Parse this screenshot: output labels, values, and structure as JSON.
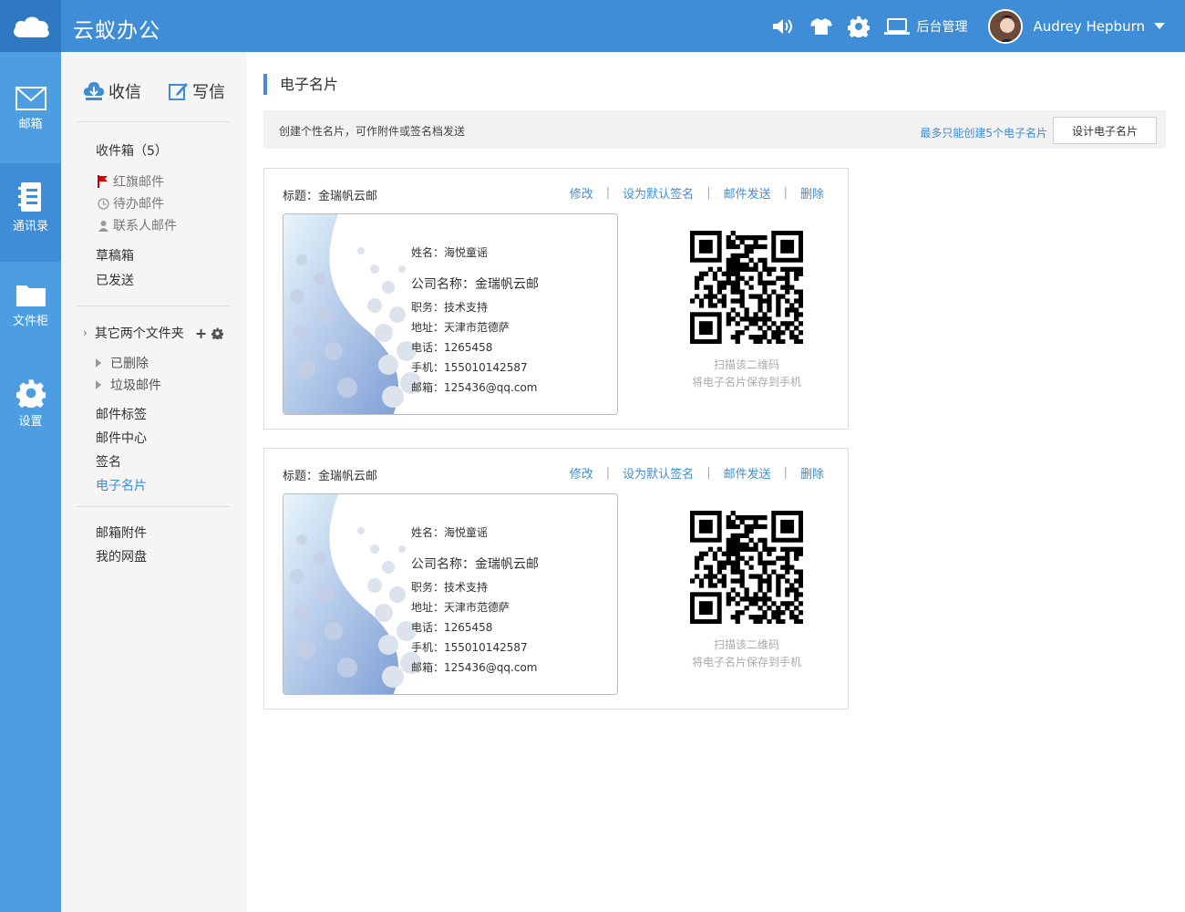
{
  "app": {
    "title": "云蚁办公"
  },
  "header": {
    "admin_label": "后台管理",
    "username": "Audrey Hepburn",
    "icons": [
      "speaker-icon",
      "tshirt-icon",
      "gear-icon",
      "laptop-icon"
    ]
  },
  "leftnav": [
    {
      "label": "邮箱",
      "icon": "envelope-icon"
    },
    {
      "label": "通讯录",
      "icon": "address-book-icon"
    },
    {
      "label": "文件柜",
      "icon": "folder-icon"
    },
    {
      "label": "设置",
      "icon": "gear-icon"
    }
  ],
  "sidebar": {
    "receive": "收信",
    "compose": "写信",
    "inbox": "收件箱（5）",
    "flagged": "红旗邮件",
    "todo": "待办邮件",
    "contacts_mail": "联系人邮件",
    "drafts": "草稿箱",
    "sent": "已发送",
    "other_folders": "其它两个文件夹",
    "deleted": "已删除",
    "spam": "垃圾邮件",
    "tags": "邮件标签",
    "mail_center": "邮件中心",
    "signature": "签名",
    "ecard": "电子名片",
    "attachments": "邮箱附件",
    "netdisk": "我的网盘"
  },
  "main": {
    "page_title": "电子名片",
    "info_text": "创建个性名片，可作附件或签名档发送",
    "limit_text": "最多只能创建5个电子名片",
    "design_button": "设计电子名片",
    "cards": [
      {
        "title": "标题：金瑞帆云邮",
        "actions": {
          "edit": "修改",
          "set_default": "设为默认签名",
          "send": "邮件发送",
          "delete": "删除"
        },
        "name": "姓名：海悦童谣",
        "company": "公司名称：金瑞帆云邮",
        "position": "职务：技术支持",
        "address": "地址：天津市范德萨",
        "phone": "电话：1265458",
        "mobile": "手机：155010142587",
        "email": "邮箱：125436@qq.com",
        "qr_caption1": "扫描该二维码",
        "qr_caption2": "将电子名片保存到手机"
      },
      {
        "title": "标题：金瑞帆云邮",
        "actions": {
          "edit": "修改",
          "set_default": "设为默认签名",
          "send": "邮件发送",
          "delete": "删除"
        },
        "name": "姓名：海悦童谣",
        "company": "公司名称：金瑞帆云邮",
        "position": "职务：技术支持",
        "address": "地址：天津市范德萨",
        "phone": "电话：1265458",
        "mobile": "手机：155010142587",
        "email": "邮箱：125436@qq.com",
        "qr_caption1": "扫描该二维码",
        "qr_caption2": "将电子名片保存到手机"
      }
    ]
  },
  "colors": {
    "primary": "#3e8dd6",
    "nav_bg": "#4d9ee0",
    "sidebar_bg": "#f5f5f5"
  }
}
